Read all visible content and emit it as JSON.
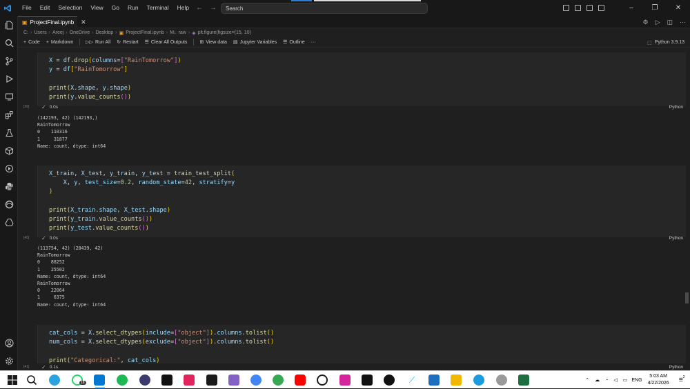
{
  "window": {
    "menu": [
      "File",
      "Edit",
      "Selection",
      "View",
      "Go",
      "Run",
      "Terminal",
      "Help"
    ],
    "search_placeholder": "Search"
  },
  "tab": {
    "filename": "ProjectFinal.ipynb",
    "close": "✕"
  },
  "breadcrumb": {
    "items": [
      "C:",
      "Users",
      "Areej",
      "OneDrive",
      "Desktop",
      "ProjectFinal.ipynb",
      "raw",
      "plt.figure(figsize=(15, 10)"
    ]
  },
  "toolbar": {
    "code": "Code",
    "markdown": "Markdown",
    "run_all": "Run All",
    "restart": "Restart",
    "clear_outputs": "Clear All Outputs",
    "view_data": "View data",
    "jupyter_variables": "Jupyter Variables",
    "outline": "Outline",
    "more": "···",
    "kernel": "Python 3.9.13"
  },
  "cells": [
    {
      "exec": "[39]",
      "time": "0.0s",
      "lang": "Python",
      "output": [
        "(142193, 42) (142193,)",
        "RainTomorrow",
        "0    110316",
        "1     31877",
        "Name: count, dtype: int64"
      ]
    },
    {
      "exec": "[40]",
      "time": "0.0s",
      "lang": "Python",
      "output": [
        "(113754, 42) (28439, 42)",
        "RainTomorrow",
        "0    88252",
        "1    25502",
        "Name: count, dtype: int64",
        "RainTomorrow",
        "0    22064",
        "1     6375",
        "Name: count, dtype: int64"
      ]
    },
    {
      "exec": "[41]",
      "time": "0.1s",
      "lang": "Python"
    }
  ],
  "taskbar": {
    "language": "ENG",
    "time": "5:03 AM",
    "date": "4/22/2026",
    "badge": "18",
    "notification_count": "2"
  },
  "colors": {
    "accent": "#0078d4",
    "editor_bg": "#1f1f1f",
    "cell_bg": "#262626",
    "success": "#89d185"
  }
}
